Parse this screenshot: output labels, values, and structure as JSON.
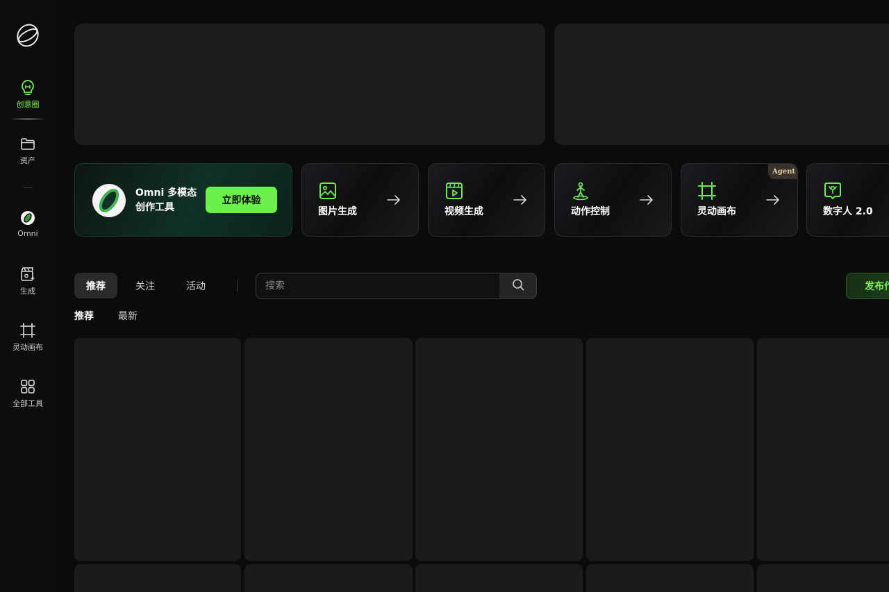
{
  "sidebar": {
    "logo": "app-logo",
    "items": [
      {
        "label": "创意圈",
        "icon": "lightbulb-icon",
        "active": true
      },
      {
        "label": "资产",
        "icon": "folder-icon"
      },
      {
        "label": "Omni",
        "icon": "omni-ring-icon"
      },
      {
        "label": "生成",
        "icon": "clapper-sparkle-icon"
      },
      {
        "label": "灵动画布",
        "icon": "canvas-frame-icon"
      },
      {
        "label": "全部工具",
        "icon": "grid-apps-icon"
      }
    ]
  },
  "omni_card": {
    "title": "Omni 多模态创作工具",
    "button": "立即体验"
  },
  "tools": [
    {
      "name": "图片生成",
      "icon": "image-icon"
    },
    {
      "name": "视频生成",
      "icon": "video-icon"
    },
    {
      "name": "动作控制",
      "icon": "motion-figure-icon"
    },
    {
      "name": "灵动画布",
      "icon": "canvas-frame-icon",
      "badge": "Agent"
    },
    {
      "name": "数字人 2.0",
      "icon": "digital-human-icon"
    }
  ],
  "feed_tabs": [
    "推荐",
    "关注",
    "活动"
  ],
  "search": {
    "placeholder": "搜索"
  },
  "publish_label": "发布作品",
  "sub_tabs": [
    "推荐",
    "最新"
  ],
  "colors": {
    "accent": "#6cf14a",
    "background": "#0b0b0c",
    "card": "#1b1b1c",
    "agent_badge": "#3a332b"
  }
}
